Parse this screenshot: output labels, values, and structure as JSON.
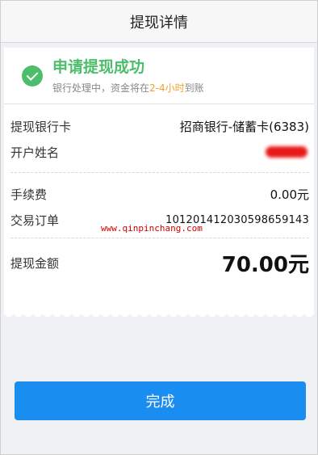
{
  "header": {
    "title": "提现详情"
  },
  "status": {
    "title": "申请提现成功",
    "subtitle_prefix": "银行处理中，资金将在",
    "subtitle_highlight": "2-4小时",
    "subtitle_suffix": "到账"
  },
  "details": {
    "bank_card_label": "提现银行卡",
    "bank_card_value": "招商银行-储蓄卡(6383)",
    "account_name_label": "开户姓名",
    "fee_label": "手续费",
    "fee_value": "0.00元",
    "order_label": "交易订单",
    "order_value": "101201412030598659143",
    "amount_label": "提现金额",
    "amount_value": "70.00元"
  },
  "watermark": "www.qinpinchang.com",
  "actions": {
    "done_label": "完成"
  },
  "colors": {
    "success_green": "#4cbe6b",
    "button_blue": "#1a8df0",
    "highlight_orange": "#f2a22c"
  }
}
